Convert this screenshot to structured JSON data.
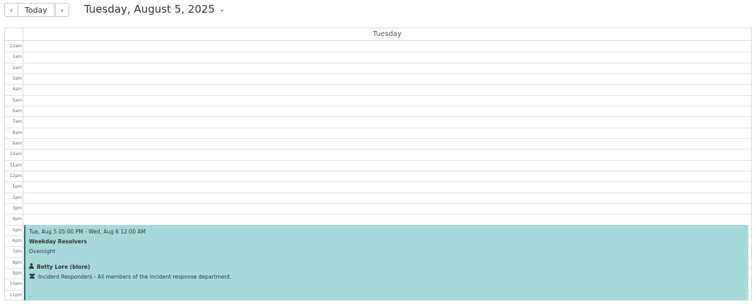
{
  "toolbar": {
    "prev_label": "‹",
    "today_label": "Today",
    "next_label": "›"
  },
  "date_title": "Tuesday, August 5, 2025",
  "date_chevron": "⌄",
  "calendar": {
    "day_header": "Tuesday",
    "hours": [
      "12am",
      "1am",
      "2am",
      "3am",
      "4am",
      "5am",
      "6am",
      "7am",
      "8am",
      "9am",
      "10am",
      "11am",
      "12pm",
      "1pm",
      "2pm",
      "3pm",
      "4pm",
      "5pm",
      "6pm",
      "7pm",
      "8pm",
      "9pm",
      "10pm",
      "11pm"
    ]
  },
  "event": {
    "time_range": "Tue, Aug 5 05:00 PM - Wed, Aug 6 12:00 AM",
    "schedule_name": "Weekday Resolvers",
    "layer_name": "Overnight",
    "person": "Betty Lore (blore)",
    "team": "Incident Responders - All members of the incident response department.",
    "color": "#a6d9d9",
    "border_color": "#2b6b6b"
  }
}
